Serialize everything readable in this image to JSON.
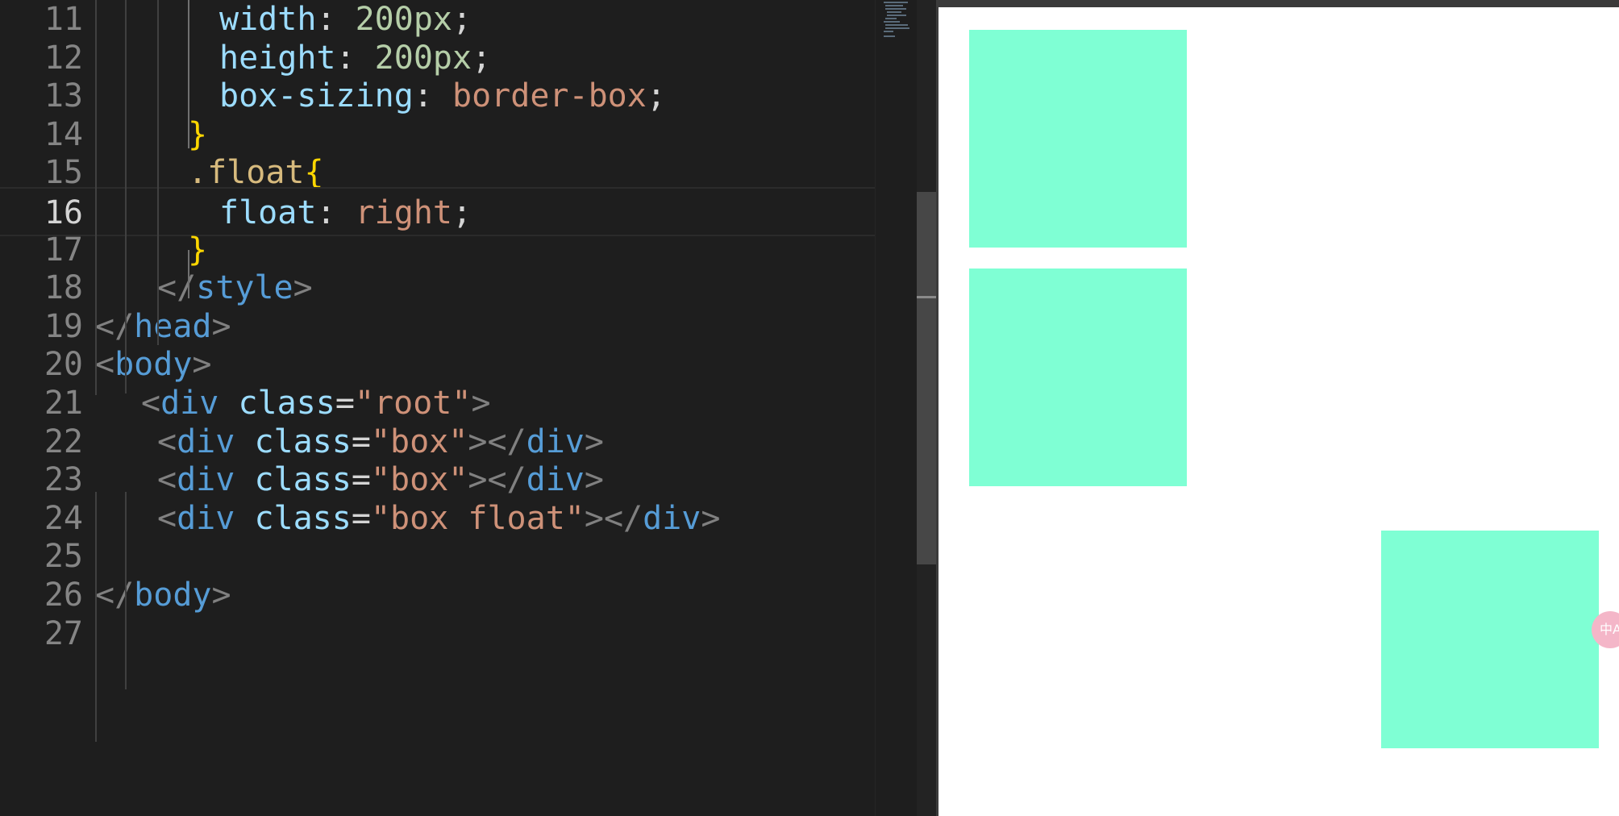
{
  "editor": {
    "lines": [
      {
        "num": "11",
        "tokens": [
          {
            "t": "width",
            "c": "prop"
          },
          {
            "t": ": ",
            "c": "plain"
          },
          {
            "t": "200px",
            "c": "num"
          },
          {
            "t": ";",
            "c": "plain"
          }
        ]
      },
      {
        "num": "12",
        "tokens": [
          {
            "t": "height",
            "c": "prop"
          },
          {
            "t": ": ",
            "c": "plain"
          },
          {
            "t": "200px",
            "c": "num"
          },
          {
            "t": ";",
            "c": "plain"
          }
        ]
      },
      {
        "num": "13",
        "tokens": [
          {
            "t": "box-sizing",
            "c": "prop"
          },
          {
            "t": ": ",
            "c": "plain"
          },
          {
            "t": "border-box",
            "c": "val"
          },
          {
            "t": ";",
            "c": "plain"
          }
        ]
      },
      {
        "num": "14",
        "tokens": [
          {
            "t": "}",
            "c": "brace"
          }
        ]
      },
      {
        "num": "15",
        "tokens": [
          {
            "t": ".float",
            "c": "sel"
          },
          {
            "t": "{",
            "c": "brace"
          }
        ]
      },
      {
        "num": "16",
        "tokens": [
          {
            "t": "float",
            "c": "prop"
          },
          {
            "t": ": ",
            "c": "plain"
          },
          {
            "t": "right",
            "c": "val"
          },
          {
            "t": ";",
            "c": "plain"
          }
        ]
      },
      {
        "num": "17",
        "tokens": [
          {
            "t": "}",
            "c": "brace"
          }
        ]
      },
      {
        "num": "18",
        "tokens": [
          {
            "t": "</",
            "c": "punc"
          },
          {
            "t": "style",
            "c": "tag"
          },
          {
            "t": ">",
            "c": "punc"
          }
        ]
      },
      {
        "num": "19",
        "tokens": [
          {
            "t": "</",
            "c": "punc"
          },
          {
            "t": "head",
            "c": "tag"
          },
          {
            "t": ">",
            "c": "punc"
          }
        ]
      },
      {
        "num": "20",
        "tokens": [
          {
            "t": "<",
            "c": "punc"
          },
          {
            "t": "body",
            "c": "tag"
          },
          {
            "t": ">",
            "c": "punc"
          }
        ]
      },
      {
        "num": "21",
        "tokens": [
          {
            "t": "<",
            "c": "punc"
          },
          {
            "t": "div",
            "c": "tag"
          },
          {
            "t": " ",
            "c": "plain"
          },
          {
            "t": "class",
            "c": "attr"
          },
          {
            "t": "=",
            "c": "plain"
          },
          {
            "t": "\"root\"",
            "c": "str"
          },
          {
            "t": ">",
            "c": "punc"
          }
        ]
      },
      {
        "num": "22",
        "tokens": [
          {
            "t": "<",
            "c": "punc"
          },
          {
            "t": "div",
            "c": "tag"
          },
          {
            "t": " ",
            "c": "plain"
          },
          {
            "t": "class",
            "c": "attr"
          },
          {
            "t": "=",
            "c": "plain"
          },
          {
            "t": "\"box\"",
            "c": "str"
          },
          {
            "t": "></",
            "c": "punc"
          },
          {
            "t": "div",
            "c": "tag"
          },
          {
            "t": ">",
            "c": "punc"
          }
        ]
      },
      {
        "num": "23",
        "tokens": [
          {
            "t": "<",
            "c": "punc"
          },
          {
            "t": "div",
            "c": "tag"
          },
          {
            "t": " ",
            "c": "plain"
          },
          {
            "t": "class",
            "c": "attr"
          },
          {
            "t": "=",
            "c": "plain"
          },
          {
            "t": "\"box\"",
            "c": "str"
          },
          {
            "t": "></",
            "c": "punc"
          },
          {
            "t": "div",
            "c": "tag"
          },
          {
            "t": ">",
            "c": "punc"
          }
        ]
      },
      {
        "num": "24",
        "tokens": [
          {
            "t": "<",
            "c": "punc"
          },
          {
            "t": "div",
            "c": "tag"
          },
          {
            "t": " ",
            "c": "plain"
          },
          {
            "t": "class",
            "c": "attr"
          },
          {
            "t": "=",
            "c": "plain"
          },
          {
            "t": "\"box float\"",
            "c": "str"
          },
          {
            "t": "></",
            "c": "punc"
          },
          {
            "t": "div",
            "c": "tag"
          },
          {
            "t": ">",
            "c": "punc"
          }
        ]
      },
      {
        "num": "25",
        "tokens": []
      },
      {
        "num": "26",
        "tokens": [
          {
            "t": "</",
            "c": "punc"
          },
          {
            "t": "body",
            "c": "tag"
          },
          {
            "t": ">",
            "c": "punc"
          }
        ]
      },
      {
        "num": "27",
        "tokens": []
      }
    ],
    "current_line": "16"
  },
  "colors": {
    "box_fill": "#7fffd4",
    "editor_bg": "#1e1e1e",
    "preview_bg": "#ffffff"
  },
  "preview": {
    "boxes": [
      "box",
      "box",
      "box float"
    ],
    "badge_text": "中A"
  }
}
